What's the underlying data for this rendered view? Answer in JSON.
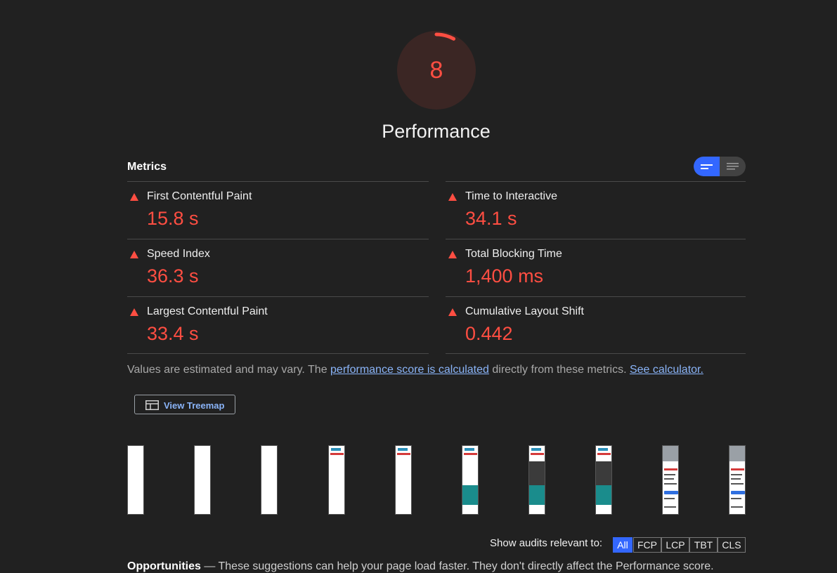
{
  "score": {
    "value": 8,
    "fraction": 0.08,
    "color": "#ff4e42"
  },
  "category": {
    "title": "Performance"
  },
  "metrics": {
    "header": "Metrics",
    "toggle": {
      "active_icon": "list-detailed-icon",
      "inactive_icon": "list-compact-icon",
      "accent": "#3367ff"
    },
    "items": [
      {
        "label": "First Contentful Paint",
        "value": "15.8 s"
      },
      {
        "label": "Time to Interactive",
        "value": "34.1 s"
      },
      {
        "label": "Speed Index",
        "value": "36.3 s"
      },
      {
        "label": "Total Blocking Time",
        "value": "1,400 ms"
      },
      {
        "label": "Largest Contentful Paint",
        "value": "33.4 s"
      },
      {
        "label": "Cumulative Layout Shift",
        "value": "0.442"
      }
    ]
  },
  "note": {
    "prefix": "Values are estimated and may vary. The ",
    "link1": "performance score is calculated",
    "middle": " directly from these metrics. ",
    "link2": "See calculator."
  },
  "treemap": {
    "label": "View Treemap",
    "icon": "treemap-icon"
  },
  "audits_filter": {
    "label": "Show audits relevant to:",
    "options": [
      "All",
      "FCP",
      "LCP",
      "TBT",
      "CLS"
    ],
    "selected": "All"
  },
  "bottom_text": {
    "bold": "Opportunities",
    "rest": " — These suggestions can help your page load faster. They don't directly affect the Performance score."
  }
}
